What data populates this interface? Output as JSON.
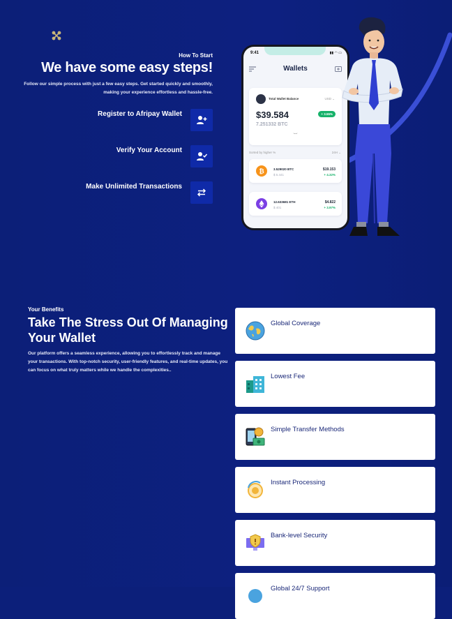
{
  "hero": {
    "eyebrow": "How To Start",
    "title": "We have some easy steps!",
    "description": "Follow our simple process with just a few easy steps. Get started quickly and smoothly, making your experience effortless and hassle-free.",
    "steps": [
      {
        "label": "Register to Afripay Wallet",
        "icon": "add-user-icon"
      },
      {
        "label": "Verify Your Account",
        "icon": "user-check-icon"
      },
      {
        "label": "Make Unlimited Transactions",
        "icon": "transfer-arrows-icon"
      }
    ]
  },
  "phone": {
    "time": "9:41",
    "title": "Wallets",
    "balance_label": "Total Wallet Balance",
    "currency": "USD",
    "balance": "$39.584",
    "change": "+ 3.55%",
    "btc_balance": "7.251332 BTC",
    "sort_label": "Sorted by higher %",
    "sort_range": "24H",
    "coins": [
      {
        "qty": "3.529020 BTC",
        "usd": "$ 5.441",
        "price": "$19.153",
        "pct": "+ 4.32%",
        "color": "#f7931a"
      },
      {
        "qty": "12.633681 ETH",
        "usd": "$ 401",
        "price": "$4.822",
        "pct": "+ 3.97%",
        "color": "#7b3fe4"
      }
    ]
  },
  "benefits": {
    "eyebrow": "Your Benefits",
    "title": "Take The Stress Out Of Managing Your Wallet",
    "description": "Our platform offers a seamless experience, allowing you to effortlessly track and manage your transactions. With top-notch security, user-friendly features, and real-time updates, you can focus on what truly matters while we handle the complexities..",
    "items": [
      {
        "label": "Global Coverage",
        "icon": "globe-icon"
      },
      {
        "label": "Lowest Fee",
        "icon": "building-fee-icon"
      },
      {
        "label": "Simple Transfer Methods",
        "icon": "phone-money-icon"
      },
      {
        "label": "Instant Processing",
        "icon": "coin-clock-icon"
      },
      {
        "label": "Bank-level Security",
        "icon": "shield-monitor-icon"
      },
      {
        "label": "Global 24/7 Support",
        "icon": "support-icon"
      }
    ]
  },
  "colors": {
    "background": "#0c1f7a",
    "step_button": "#0f2aa8",
    "positive": "#17b26a",
    "card_text": "#1a2878"
  }
}
